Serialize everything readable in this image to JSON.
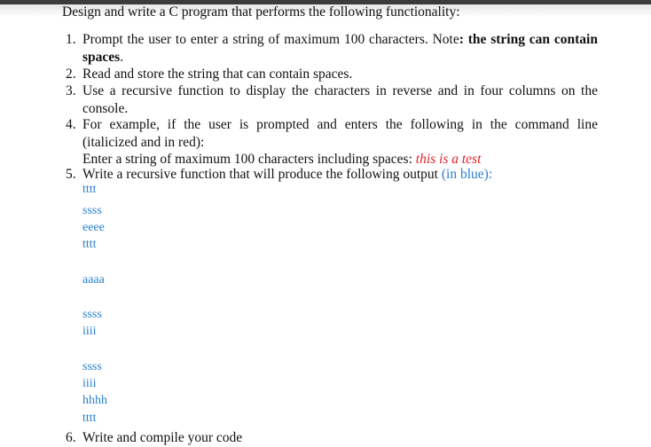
{
  "heading": "Design and write a C program that performs the following functionality:",
  "items": [
    {
      "num": "1.",
      "text_a": "Prompt the user to enter a string of maximum 100 characters. Note",
      "text_bold": ": the string can contain",
      "text_bold2": "spaces",
      "text_end": "."
    },
    {
      "num": "2.",
      "text": "Read and store the string that can contain spaces."
    },
    {
      "num": "3.",
      "line1": "Use a recursive function to display the characters in reverse and in four columns on the",
      "line2": "console."
    },
    {
      "num": "4.",
      "line1": "For example, if the user is prompted and enters the following in the command line",
      "line2": "(italicized and in red):",
      "prompt": "Enter a string of maximum 100 characters including spaces: ",
      "input_red": "this is a test"
    },
    {
      "num": "5.",
      "text": "Write a recursive function that will produce the following output ",
      "blue_note": "(in blue):"
    },
    {
      "num": "6.",
      "text": "Write and compile your code"
    }
  ],
  "output_lines": [
    "tttt",
    "ssss",
    "eeee",
    "tttt",
    "",
    "aaaa",
    "",
    "ssss",
    "iiii",
    "",
    "ssss",
    "iiii",
    "hhhh",
    "tttt"
  ],
  "colors": {
    "red_input": "#e0222a",
    "blue_output": "#2a7fd0",
    "top_bar": "#3a3b3d"
  }
}
